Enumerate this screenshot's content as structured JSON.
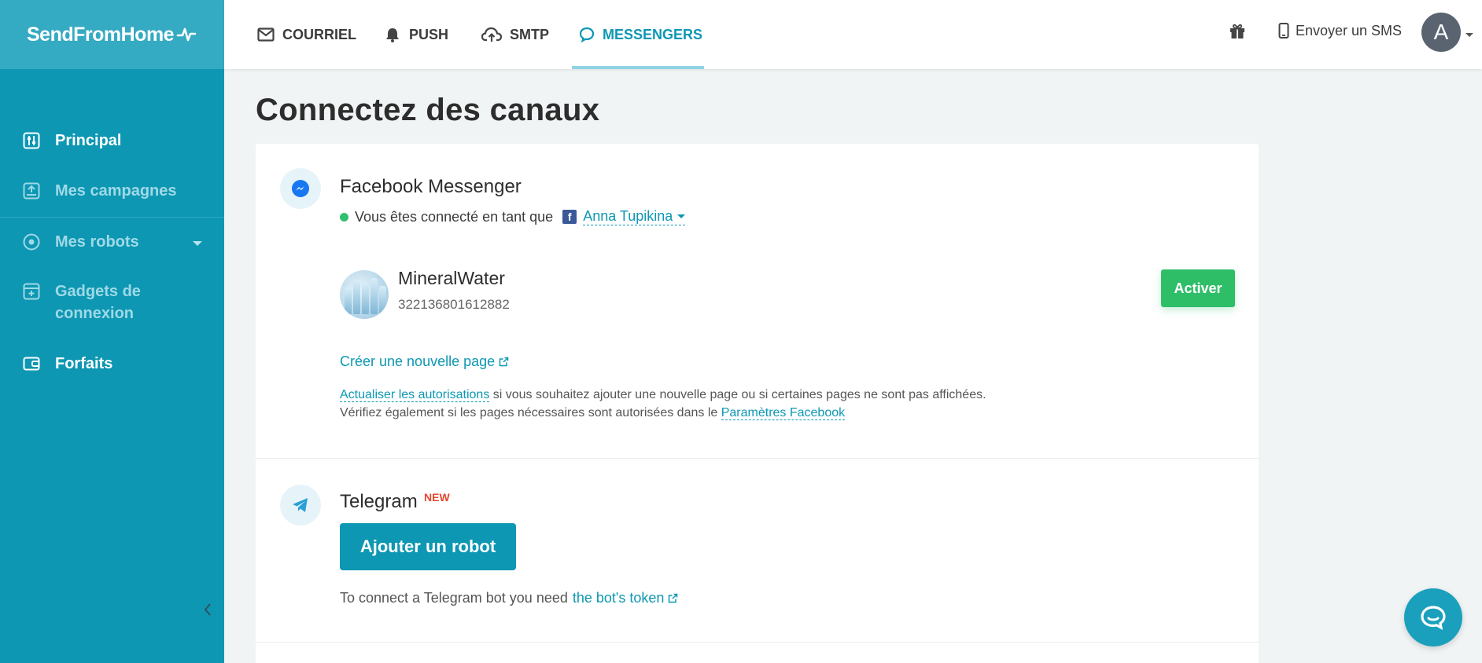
{
  "brand": {
    "name": "SendFromHome"
  },
  "sidebar": {
    "items": [
      {
        "label": "Principal",
        "icon": "sliders-icon"
      },
      {
        "label": "Mes campagnes",
        "icon": "campaign-icon"
      },
      {
        "label": "Mes robots",
        "icon": "robot-globe-icon"
      },
      {
        "label": "Gadgets de connexion",
        "icon": "widget-icon"
      },
      {
        "label": "Forfaits",
        "icon": "wallet-icon"
      }
    ]
  },
  "header": {
    "tabs": [
      {
        "label": "COURRIEL",
        "icon": "mail-icon"
      },
      {
        "label": "PUSH",
        "icon": "bell-icon"
      },
      {
        "label": "SMTP",
        "icon": "cloud-upload-icon"
      },
      {
        "label": "MESSENGERS",
        "icon": "chat-bubble-icon"
      }
    ],
    "active_tab": "MESSENGERS",
    "sms_label": "Envoyer un SMS",
    "avatar_letter": "A"
  },
  "main": {
    "title": "Connectez des canaux",
    "facebook": {
      "title": "Facebook Messenger",
      "status_text": "Vous êtes connecté en tant que",
      "account_name": "Anna Tupikina",
      "page": {
        "name": "MineralWater",
        "id": "322136801612882"
      },
      "activate_label": "Activer",
      "create_page_label": "Créer une nouvelle page",
      "note_link1": "Actualiser les autorisations",
      "note_text1": " si vous souhaitez ajouter une nouvelle page ou si certaines pages ne sont pas affichées.",
      "note_text2": "Vérifiez également si les pages nécessaires sont autorisées dans le ",
      "note_link2": "Paramètres Facebook"
    },
    "telegram": {
      "title": "Telegram",
      "badge": "NEW",
      "add_robot_label": "Ajouter un robot",
      "hint_text": "To connect a Telegram bot you need",
      "hint_link": "the bot's token"
    }
  },
  "colors": {
    "primary": "#0d97b3",
    "success": "#2fbe68",
    "new_badge": "#e2492f"
  }
}
